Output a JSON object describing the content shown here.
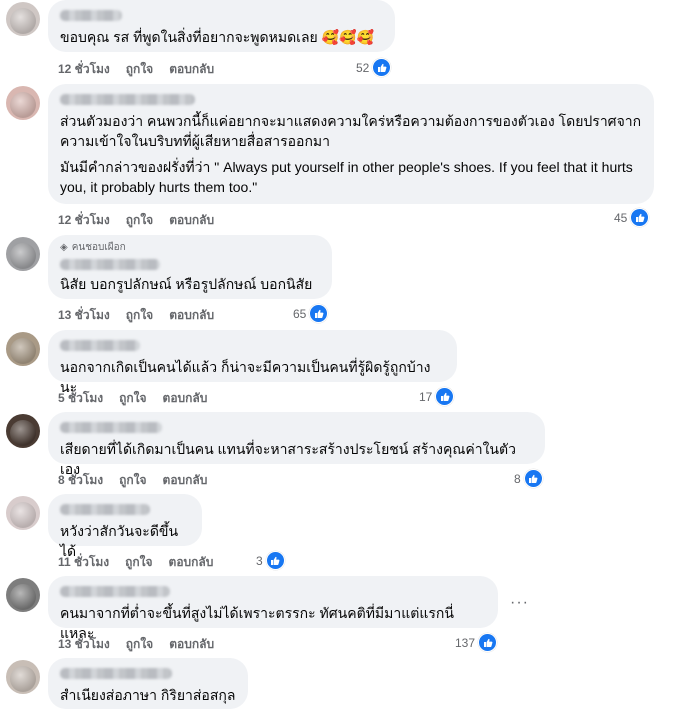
{
  "comments": [
    {
      "text": [
        "ขอบคุณ รส ที่พูดในสิ่งที่อยากจะพูดหมดเลย 🥰🥰🥰"
      ],
      "time": "12 ชั่วโมง",
      "like": "ถูกใจ",
      "reply": "ตอบกลับ",
      "reactions": "52"
    },
    {
      "text": [
        "ส่วนตัวมองว่า คนพวกนี้ก็แค่อยากจะมาแสดงความใคร่หรือความต้องการของตัวเอง โดยปราศจากความเข้าใจในบริบทที่ผู้เสียหายสื่อสารออกมา",
        "มันมีคำกล่าวของฝรั่งที่ว่า \" Always put yourself in other people's shoes. If you feel that it hurts you, it probably hurts them too.\""
      ],
      "time": "12 ชั่วโมง",
      "like": "ถูกใจ",
      "reply": "ตอบกลับ",
      "reactions": "45"
    },
    {
      "badge": "คนชอบเผือก",
      "text": [
        "นิสัย บอกรูปลักษณ์ หรือรูปลักษณ์ บอกนิสัย"
      ],
      "time": "13 ชั่วโมง",
      "like": "ถูกใจ",
      "reply": "ตอบกลับ",
      "reactions": "65"
    },
    {
      "text": [
        "นอกจากเกิดเป็นคนได้แล้ว ก็น่าจะมีความเป็นคนที่รู้ผิดรู้ถูกบ้างนะ"
      ],
      "time": "5 ชั่วโมง",
      "like": "ถูกใจ",
      "reply": "ตอบกลับ",
      "reactions": "17"
    },
    {
      "text": [
        "เสียดายที่ได้เกิดมาเป็นคน แทนที่จะหาสาระสร้างประโยชน์ สร้างคุณค่าในตัวเอง"
      ],
      "time": "8 ชั่วโมง",
      "like": "ถูกใจ",
      "reply": "ตอบกลับ",
      "reactions": "8"
    },
    {
      "text": [
        "หวังว่าสักวันจะดีขึ้นได้"
      ],
      "time": "11 ชั่วโมง",
      "like": "ถูกใจ",
      "reply": "ตอบกลับ",
      "reactions": "3"
    },
    {
      "text": [
        "คนมาจากที่ต่ำจะขึ้นที่สูงไม่ได้เพราะตรรกะ ทัศนคติที่มีมาแต่แรกนี่แหละ"
      ],
      "time": "13 ชั่วโมง",
      "like": "ถูกใจ",
      "reply": "ตอบกลับ",
      "reactions": "137",
      "more": "···"
    },
    {
      "text": [
        "สำเนียงส่อภาษา กิริยาส่อสกุล"
      ]
    }
  ],
  "icons": {
    "reaction": "like-icon",
    "badge": "gem-icon",
    "more": "more-options-icon"
  },
  "colors": {
    "like_blue": "#1877f2",
    "bubble": "#f0f2f5",
    "meta": "#65676b"
  }
}
